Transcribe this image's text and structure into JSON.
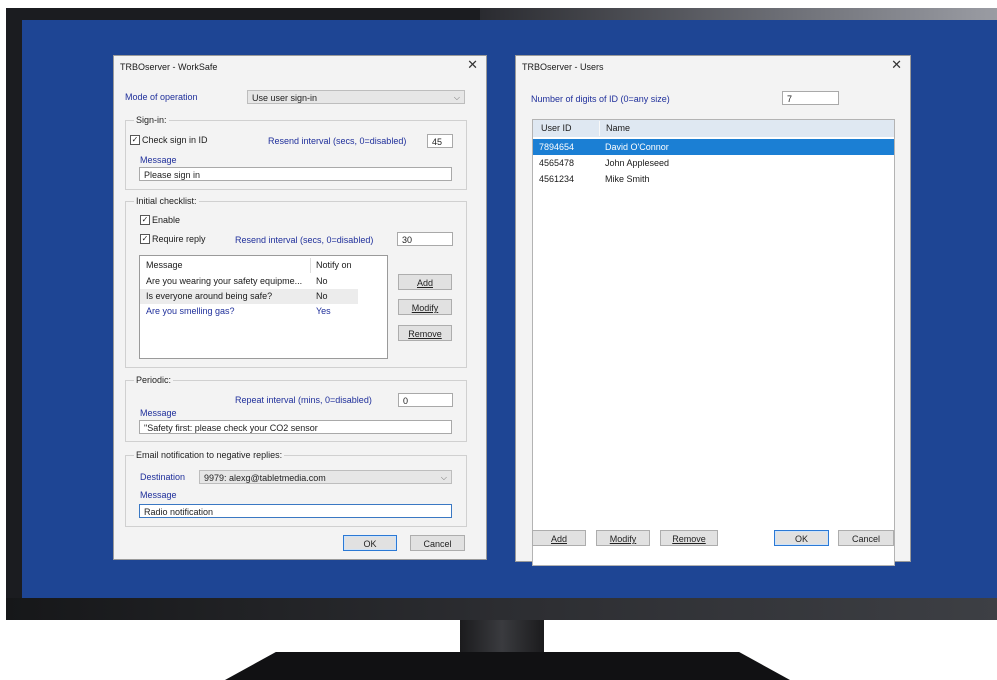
{
  "workSafe": {
    "title": "TRBOserver - WorkSafe",
    "mode_label": "Mode of operation",
    "mode_value": "Use user sign-in",
    "signIn": {
      "group": "Sign-in:",
      "check_label": "Check sign in ID",
      "check_on": true,
      "resend_label": "Resend interval (secs, 0=disabled)",
      "resend_value": "45",
      "message_label": "Message",
      "message_value": "Please sign in"
    },
    "checklist": {
      "group": "Initial checklist:",
      "enable_label": "Enable",
      "require_label": "Require reply",
      "resend_label": "Resend interval (secs, 0=disabled)",
      "resend_value": "30",
      "col_message": "Message",
      "col_notify": "Notify on",
      "rows": [
        {
          "message": "Are you wearing your safety equipme...",
          "notify": "No"
        },
        {
          "message": "Is everyone around being safe?",
          "notify": "No"
        },
        {
          "message": "Are you smelling gas?",
          "notify": "Yes"
        }
      ],
      "add": "Add",
      "modify": "Modify",
      "remove": "Remove"
    },
    "periodic": {
      "group": "Periodic:",
      "repeat_label": "Repeat interval (mins, 0=disabled)",
      "repeat_value": "0",
      "message_label": "Message",
      "message_value": "\"Safety first: please check your CO2 sensor"
    },
    "email": {
      "group": "Email notification to negative replies:",
      "dest_label": "Destination",
      "dest_value": "9979: alexg@tabletmedia.com",
      "message_label": "Message",
      "message_value": "Radio notification"
    },
    "ok": "OK",
    "cancel": "Cancel"
  },
  "users": {
    "title": "TRBOserver - Users",
    "digits_label": "Number of digits of ID (0=any  size)",
    "digits_value": "7",
    "col_id": "User ID",
    "col_name": "Name",
    "rows": [
      {
        "id": "7894654",
        "name": "David O'Connor"
      },
      {
        "id": "4565478",
        "name": "John Appleseed"
      },
      {
        "id": "4561234",
        "name": "Mike Smith"
      }
    ],
    "selected_row": 0,
    "add": "Add",
    "modify": "Modify",
    "remove": "Remove",
    "ok": "OK",
    "cancel": "Cancel"
  },
  "colors": {
    "desktop": "#1e4594",
    "selection": "#1b7fd4",
    "label_blue": "#1f2f9b"
  }
}
